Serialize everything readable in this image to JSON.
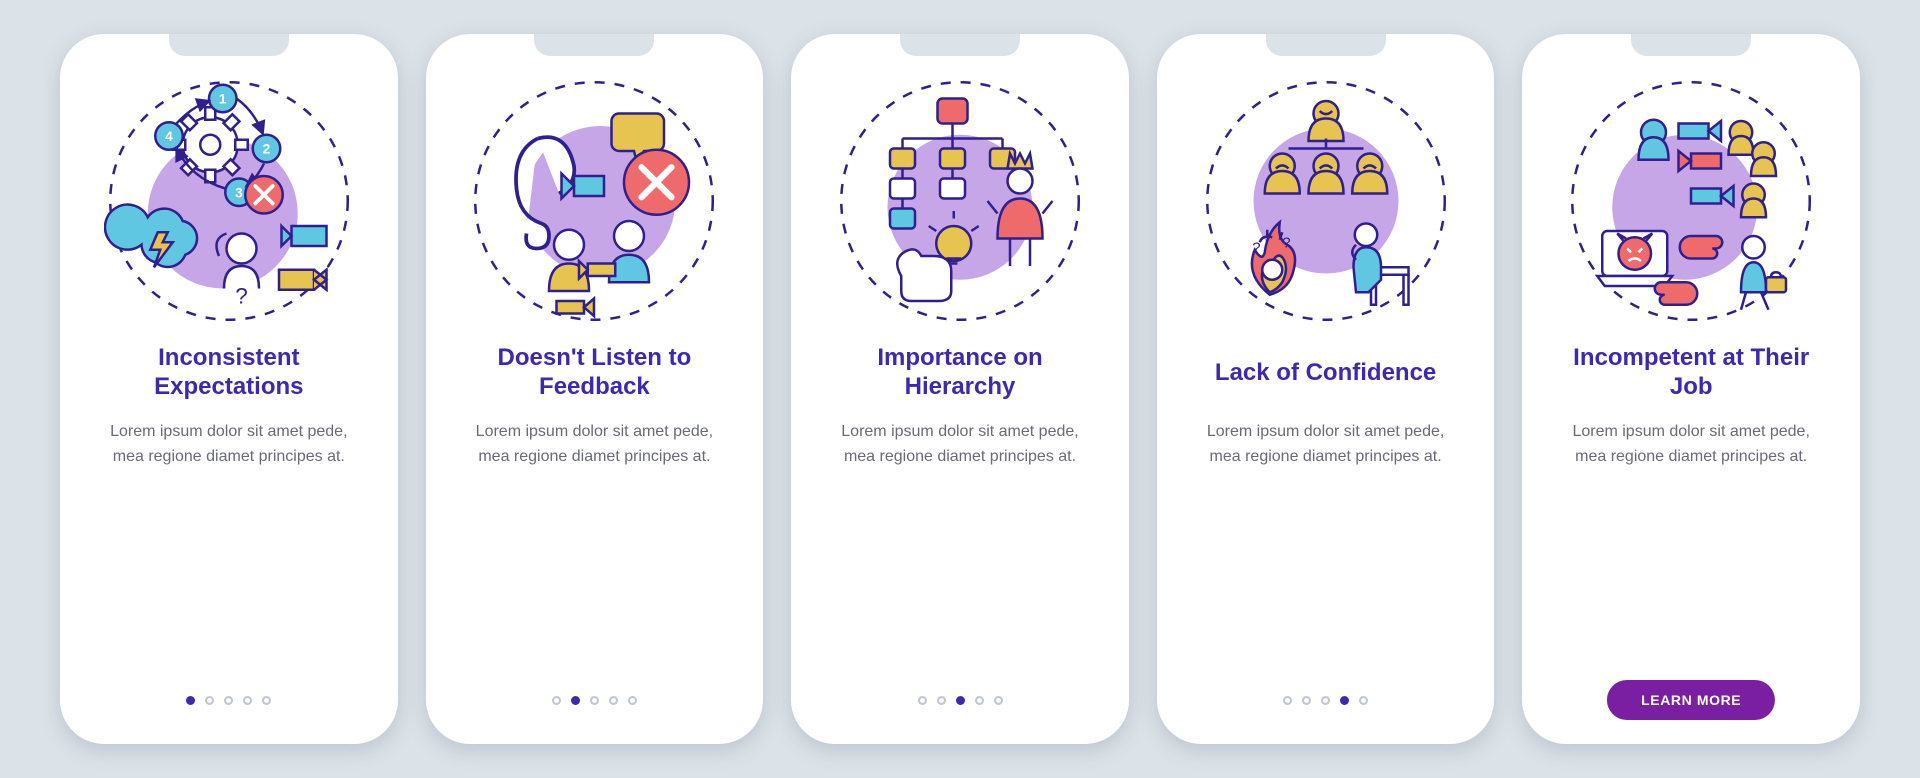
{
  "colors": {
    "purple_fill": "#c7a6e8",
    "purple_line": "#2f1f8f",
    "cyan": "#5fc7e2",
    "salmon": "#ef6a6a",
    "mustard": "#e7c44f",
    "cta_bg": "#7a1fa2",
    "title": "#3f27b5"
  },
  "screens": [
    {
      "title": "Inconsistent Expectations",
      "desc": "Lorem ipsum dolor sit amet pede, mea regione diamet principes at.",
      "active_index": 0
    },
    {
      "title": "Doesn't Listen to Feedback",
      "desc": "Lorem ipsum dolor sit amet pede, mea regione diamet principes at.",
      "active_index": 1
    },
    {
      "title": "Importance on Hierarchy",
      "desc": "Lorem ipsum dolor sit amet pede, mea regione diamet principes at.",
      "active_index": 2
    },
    {
      "title": "Lack of Confidence",
      "desc": "Lorem ipsum dolor sit amet pede, mea regione diamet principes at.",
      "active_index": 3
    },
    {
      "title": "Incompetent at Their Job",
      "desc": "Lorem ipsum dolor sit amet pede, mea regione diamet principes at.",
      "active_index": 4
    }
  ],
  "total_dots": 5,
  "cta_label": "LEARN MORE"
}
